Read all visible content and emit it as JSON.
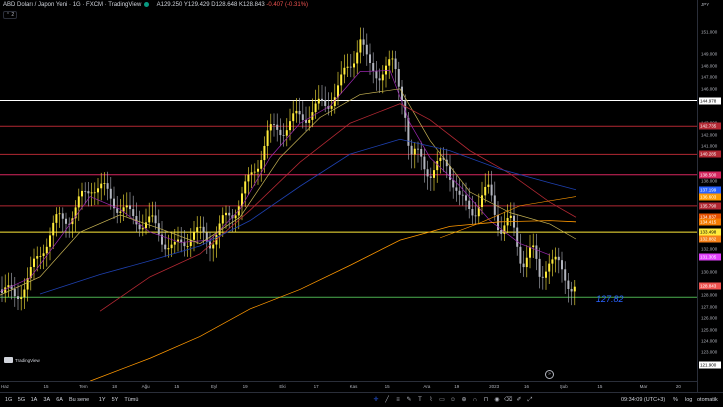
{
  "header": {
    "title": "ABD Doları / Japon Yeni · 1G · FXCM · TradingView",
    "ohlc": {
      "o": "A129.250",
      "h": "Y129.429",
      "l": "D128.648",
      "c": "K128.843",
      "chg": "-0.407 (-0.31%)"
    },
    "collapse_label": "⌃ 2"
  },
  "currency": "JPY",
  "price_ticks": [
    "151.000",
    "149.000",
    "148.000",
    "147.000",
    "146.000",
    "143.000",
    "142.000",
    "141.000",
    "138.000",
    "132.000",
    "130.000",
    "129.000",
    "128.000",
    "127.000",
    "126.000",
    "125.000",
    "124.000",
    "123.000"
  ],
  "price_badges": [
    {
      "label": "144.978",
      "color": "#ffffff",
      "text": "#000000",
      "price": 144.978
    },
    {
      "label": "142.735",
      "color": "#b22833",
      "text": "#ffffff",
      "price": 142.735
    },
    {
      "label": "140.285",
      "color": "#b22833",
      "text": "#ffffff",
      "price": 140.285
    },
    {
      "label": "138.500",
      "color": "#d5255e",
      "text": "#ffffff",
      "price": 138.5
    },
    {
      "label": "137.199",
      "color": "#2962ff",
      "text": "#ffffff",
      "price": 137.199
    },
    {
      "label": "136.603",
      "color": "#ff9800",
      "text": "#ffffff",
      "price": 136.603
    },
    {
      "label": "135.790",
      "color": "#b22833",
      "text": "#ffffff",
      "price": 135.79
    },
    {
      "label": "134.837",
      "color": "#e65100",
      "text": "#ffffff",
      "price": 134.837
    },
    {
      "label": "134.415",
      "color": "#f57c00",
      "text": "#ffffff",
      "price": 134.415
    },
    {
      "label": "133.498",
      "color": "#ffeb3b",
      "text": "#000000",
      "price": 133.498
    },
    {
      "label": "132.882",
      "color": "#f57f17",
      "text": "#ffffff",
      "price": 132.882
    },
    {
      "label": "131.305",
      "color": "#e040fb",
      "text": "#ffffff",
      "price": 131.305
    },
    {
      "label": "128.843",
      "color": "#ef5350",
      "text": "#ffffff",
      "price": 128.843
    },
    {
      "label": "121.900",
      "color": "#ffffff",
      "text": "#000000",
      "price": 121.9
    }
  ],
  "time_ticks": [
    "Haz",
    "15",
    "Tem",
    "18",
    "Ağu",
    "15",
    "Eyl",
    "19",
    "Eki",
    "17",
    "Kas",
    "15",
    "Ara",
    "19",
    "2023",
    "16",
    "Şub",
    "15",
    "Mar",
    "20"
  ],
  "horizontal_levels": [
    {
      "price": 144.978,
      "color": "#ffffff"
    },
    {
      "price": 142.735,
      "color": "#b22833"
    },
    {
      "price": 140.285,
      "color": "#b22833"
    },
    {
      "price": 138.5,
      "color": "#d5255e"
    },
    {
      "price": 135.79,
      "color": "#b22833"
    },
    {
      "price": 133.498,
      "color": "#ffeb3b"
    },
    {
      "price": 127.82,
      "color": "#4caf50"
    }
  ],
  "level_label": "127.82",
  "bottom_bar": {
    "timeframes": [
      "1G",
      "5G",
      "1A",
      "3A",
      "6A",
      "Bu sene",
      "1Y",
      "5Y",
      "Tümü"
    ],
    "time": "09:34:09 (UTC+3)",
    "percent": "%",
    "log": "log",
    "auto": "otomatik"
  },
  "logo_text": "TradingView",
  "colors": {
    "bull": "#ffeb3b",
    "bear": "#b2b5be",
    "ma_fast": "#9c27b0",
    "ma_yellow": "#c8b454",
    "ma_red": "#b22833",
    "ma_blue": "#1e40af",
    "ma_orange": "#ff9800"
  }
}
